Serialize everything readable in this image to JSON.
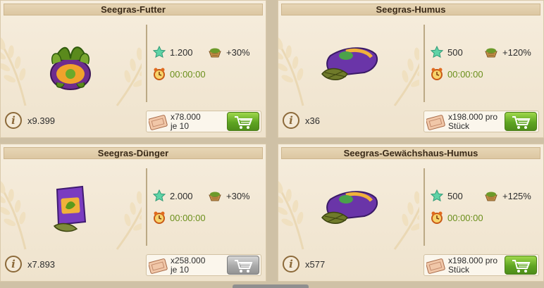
{
  "colors": {
    "accent_green": "#6a8f1b",
    "buy_enabled": "#5fa522",
    "buy_disabled": "#a9a9a9",
    "title_bg": "#dcc7a2"
  },
  "items": [
    {
      "title": "Seegras-Futter",
      "product_icon": "seaweed-pot-icon",
      "stars": "1.200",
      "bonus": "+30%",
      "time": "00:00:00",
      "count": "x9.399",
      "price_line1": "x78.000",
      "price_line2": "je 10",
      "buy_enabled": true
    },
    {
      "title": "Seegras-Humus",
      "product_icon": "humus-sack-icon",
      "stars": "500",
      "bonus": "+120%",
      "time": "00:00:00",
      "count": "x36",
      "price_line1": "x198.000 pro",
      "price_line2": "Stück",
      "buy_enabled": true
    },
    {
      "title": "Seegras-Dünger",
      "product_icon": "fertilizer-bag-icon",
      "stars": "2.000",
      "bonus": "+30%",
      "time": "00:00:00",
      "count": "x7.893",
      "price_line1": "x258.000",
      "price_line2": "je 10",
      "buy_enabled": false
    },
    {
      "title": "Seegras-Gewächshaus-Humus",
      "product_icon": "greenhouse-humus-sack-icon",
      "stars": "500",
      "bonus": "+125%",
      "time": "00:00:00",
      "count": "x577",
      "price_line1": "x198.000 pro",
      "price_line2": "Stück",
      "buy_enabled": true
    }
  ]
}
